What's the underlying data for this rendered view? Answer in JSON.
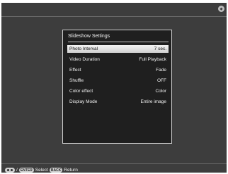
{
  "dialog": {
    "title": "Slideshow Settings",
    "items": [
      {
        "label": "Photo Interval",
        "value": "7 sec.",
        "selected": true
      },
      {
        "label": "Video Duration",
        "value": "Full Playback",
        "selected": false
      },
      {
        "label": "Effect",
        "value": "Fade",
        "selected": false
      },
      {
        "label": "Shuffle",
        "value": "OFF",
        "selected": false
      },
      {
        "label": "Color effect",
        "value": "Color",
        "selected": false
      },
      {
        "label": "Display Mode",
        "value": "Entire image",
        "selected": false
      }
    ]
  },
  "footer": {
    "nav_icon": "up-down-navigation-icon",
    "separator": "/",
    "enter_key": "ENTER",
    "select_label": "Select",
    "back_key": "BACK",
    "return_label": "Return"
  },
  "brand_icon": "brand-logo-icon",
  "colors": {
    "screen_bg": "#3d3d3d",
    "dialog_bg": "#1f1f1f",
    "highlight": "#e4e4e4"
  }
}
